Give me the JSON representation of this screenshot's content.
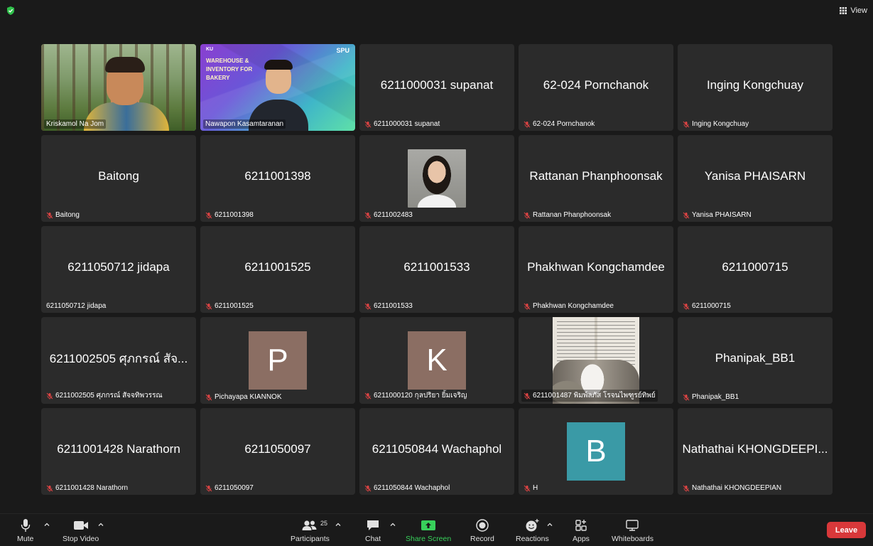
{
  "top": {
    "view_label": "View"
  },
  "tiles": [
    {
      "label": "Kriskamol Na Jom",
      "muted": false,
      "kind": "video-forest"
    },
    {
      "label": "Nawapon Kasamtaranan",
      "muted": false,
      "kind": "video-bakery",
      "slide_title": "WAREHOUSE & INVENTORY FOR BAKERY",
      "slide_logo_left": "KU",
      "slide_logo_right": "SPU"
    },
    {
      "label": "6211000031 supanat",
      "name": "6211000031 supanat",
      "muted": true
    },
    {
      "label": "62-024 Pornchanok",
      "name": "62-024 Pornchanok",
      "muted": true
    },
    {
      "label": "Inging Kongchuay",
      "name": "Inging Kongchuay",
      "muted": true
    },
    {
      "label": "Baitong",
      "name": "Baitong",
      "muted": true
    },
    {
      "label": "6211001398",
      "name": "6211001398",
      "muted": true
    },
    {
      "label": "6211002483",
      "muted": true,
      "kind": "photo-girl"
    },
    {
      "label": "Rattanan Phanphoonsak",
      "name": "Rattanan Phanphoonsak",
      "muted": true
    },
    {
      "label": "Yanisa PHAISARN",
      "name": "Yanisa PHAISARN",
      "muted": true
    },
    {
      "label": "6211050712 jidapa",
      "name": "6211050712 jidapa",
      "muted": false
    },
    {
      "label": "6211001525",
      "name": "6211001525",
      "muted": true
    },
    {
      "label": "6211001533",
      "name": "6211001533",
      "muted": true
    },
    {
      "label": "Phakhwan Kongchamdee",
      "name": "Phakhwan Kongchamdee",
      "muted": true
    },
    {
      "label": "6211000715",
      "name": "6211000715",
      "muted": true
    },
    {
      "label": "6211002505 ศุภกรณ์ สัจจทิพวรรณ",
      "name": "6211002505 ศุภกรณ์ สัจ...",
      "muted": true
    },
    {
      "label": "Pichayapa KIANNOK",
      "muted": true,
      "kind": "avatar",
      "letter": "P",
      "color": "#8b6e63"
    },
    {
      "label": "6211000120 กุลปริยา ยิ้มเจริญ",
      "muted": true,
      "kind": "avatar",
      "letter": "K",
      "color": "#8b6e63"
    },
    {
      "label": "6211001487 พิมพ์ลภัส  โรจนไพฑูรย์ทิพย์",
      "muted": true,
      "kind": "video-book"
    },
    {
      "label": "Phanipak_BB1",
      "name": "Phanipak_BB1",
      "muted": true
    },
    {
      "label": "6211001428 Narathorn",
      "name": "6211001428 Narathorn",
      "muted": true
    },
    {
      "label": "6211050097",
      "name": "6211050097",
      "muted": true
    },
    {
      "label": "6211050844 Wachaphol",
      "name": "6211050844 Wachaphol",
      "muted": true
    },
    {
      "label": "H",
      "muted": true,
      "kind": "avatar",
      "letter": "B",
      "color": "#3a9aa6"
    },
    {
      "label": "Nathathai KHONGDEEPIAN",
      "name": "Nathathai KHONGDEEPI...",
      "muted": true
    }
  ],
  "toolbar": {
    "mute": "Mute",
    "stop_video": "Stop Video",
    "participants": "Participants",
    "participants_count": "25",
    "chat": "Chat",
    "share_screen": "Share Screen",
    "record": "Record",
    "reactions": "Reactions",
    "apps": "Apps",
    "whiteboards": "Whiteboards",
    "leave": "Leave"
  },
  "colors": {
    "active_speaker": "#7bd34a",
    "share_green": "#38d15b",
    "leave_red": "#d8383a",
    "muted_red": "#e04444"
  }
}
